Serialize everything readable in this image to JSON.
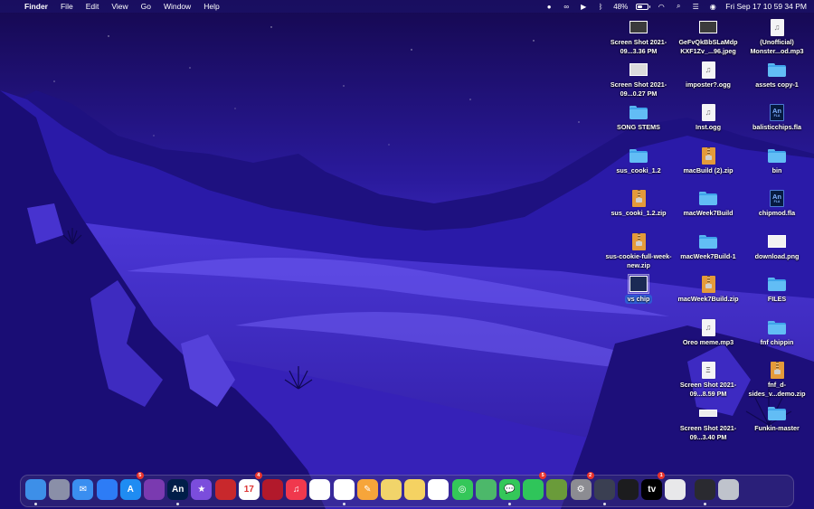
{
  "menubar": {
    "app_name": "Finder",
    "menus": [
      "File",
      "Edit",
      "View",
      "Go",
      "Window",
      "Help"
    ],
    "battery_percent": "48%",
    "clock": "Fri Sep 17  10 59 34 PM"
  },
  "desktop_icons": [
    {
      "label": "Screen Shot 2021-09...3.36 PM",
      "kind": "screenshot-dark"
    },
    {
      "label": "GeFvQkBbSLaMdp KXF1Zv_...96.jpeg",
      "kind": "screenshot-dark"
    },
    {
      "label": "(Unofficial) Monster...od.mp3",
      "kind": "audio"
    },
    {
      "label": "Screen Shot 2021-09...0.27 PM",
      "kind": "screenshot"
    },
    {
      "label": "imposter?.ogg",
      "kind": "audio"
    },
    {
      "label": "assets copy-1",
      "kind": "folder"
    },
    {
      "label": "SONG STEMS",
      "kind": "folder"
    },
    {
      "label": "Inst.ogg",
      "kind": "audio"
    },
    {
      "label": "balisticchips.fla",
      "kind": "animate"
    },
    {
      "label": "sus_cooki_1.2",
      "kind": "folder"
    },
    {
      "label": "macBuild (2).zip",
      "kind": "zip"
    },
    {
      "label": "bin",
      "kind": "folder"
    },
    {
      "label": "sus_cooki_1.2.zip",
      "kind": "zip"
    },
    {
      "label": "macWeek7Build",
      "kind": "folder"
    },
    {
      "label": "chipmod.fla",
      "kind": "animate"
    },
    {
      "label": "sus-cookie-full-week-new.zip",
      "kind": "zip"
    },
    {
      "label": "macWeek7Build-1",
      "kind": "folder"
    },
    {
      "label": "download.png",
      "kind": "screenshot-light"
    },
    {
      "label": "vs chip",
      "kind": "image-selected"
    },
    {
      "label": "macWeek7Build.zip",
      "kind": "zip"
    },
    {
      "label": "FILES",
      "kind": "folder"
    },
    {
      "label": "Oreo meme.mp3",
      "kind": "audio"
    },
    {
      "label": "fnf chippin",
      "kind": "folder"
    },
    {
      "label": "Screen Shot 2021-09...8.59 PM",
      "kind": "screenshot-sketch"
    },
    {
      "label": "fnf_d-sides_v...demo.zip",
      "kind": "zip"
    },
    {
      "label": "Screen Shot 2021-09...3.40 PM",
      "kind": "screenshot-line"
    },
    {
      "label": "Funkin-master",
      "kind": "folder"
    }
  ],
  "dock": {
    "apps": [
      {
        "name": "Finder",
        "text": "",
        "badge": "",
        "color": "#3d8fe8"
      },
      {
        "name": "Launchpad",
        "text": "",
        "badge": "",
        "color": "#8a8fa8"
      },
      {
        "name": "Mail",
        "text": "✉",
        "badge": "",
        "color": "#3a8ef0"
      },
      {
        "name": "Zoom",
        "text": "",
        "badge": "",
        "color": "#2d7cf6"
      },
      {
        "name": "App Store",
        "text": "A",
        "badge": "5",
        "color": "#1f8cf2"
      },
      {
        "name": "Burger",
        "text": "",
        "badge": "",
        "color": "#7a3ab0"
      },
      {
        "name": "Animate",
        "text": "An",
        "badge": "",
        "color": "#001e49"
      },
      {
        "name": "iMovie",
        "text": "★",
        "badge": "",
        "color": "#7b4ddc"
      },
      {
        "name": "Photo Booth",
        "text": "",
        "badge": "",
        "color": "#c8282c"
      },
      {
        "name": "Calendar",
        "text": "17",
        "badge": "4",
        "color": "#ffffff"
      },
      {
        "name": "Photo Booth Red",
        "text": "",
        "badge": "",
        "color": "#b2192b"
      },
      {
        "name": "Music",
        "text": "♫",
        "badge": "",
        "color": "#f0384d"
      },
      {
        "name": "Photos",
        "text": "",
        "badge": "",
        "color": "#ffffff"
      },
      {
        "name": "Chrome",
        "text": "",
        "badge": "",
        "color": "#ffffff"
      },
      {
        "name": "Pages",
        "text": "✎",
        "badge": "",
        "color": "#f6a53a"
      },
      {
        "name": "Stickies",
        "text": "",
        "badge": "",
        "color": "#f1d46a"
      },
      {
        "name": "Notes",
        "text": "",
        "badge": "",
        "color": "#f5d262"
      },
      {
        "name": "Reminders",
        "text": "",
        "badge": "",
        "color": "#ffffff"
      },
      {
        "name": "Find My",
        "text": "◎",
        "badge": "",
        "color": "#34c759"
      },
      {
        "name": "Maps",
        "text": "",
        "badge": "",
        "color": "#4cb86a"
      },
      {
        "name": "Messages",
        "text": "💬",
        "badge": "",
        "color": "#34c759"
      },
      {
        "name": "FaceTime",
        "text": "",
        "badge": "5",
        "color": "#2fc55a"
      },
      {
        "name": "Minecraft",
        "text": "",
        "badge": "",
        "color": "#6a9b3a"
      },
      {
        "name": "System Preferences",
        "text": "⚙",
        "badge": "2",
        "color": "#8c8c92"
      },
      {
        "name": "QuickTime",
        "text": "",
        "badge": "",
        "color": "#3a3f52"
      },
      {
        "name": "Voice Memos",
        "text": "",
        "badge": "",
        "color": "#1c1c1e"
      },
      {
        "name": "TV",
        "text": "tv",
        "badge": "1",
        "color": "#000000"
      },
      {
        "name": "Roblox",
        "text": "",
        "badge": "",
        "color": "#e8e8ea"
      },
      {
        "name": "Activity",
        "text": "",
        "badge": "",
        "color": "#2a2a30"
      },
      {
        "name": "Trash",
        "text": "",
        "badge": "",
        "color": "#bfc3cc"
      }
    ],
    "running_dots": [
      0,
      6,
      13,
      20,
      24,
      28
    ]
  }
}
